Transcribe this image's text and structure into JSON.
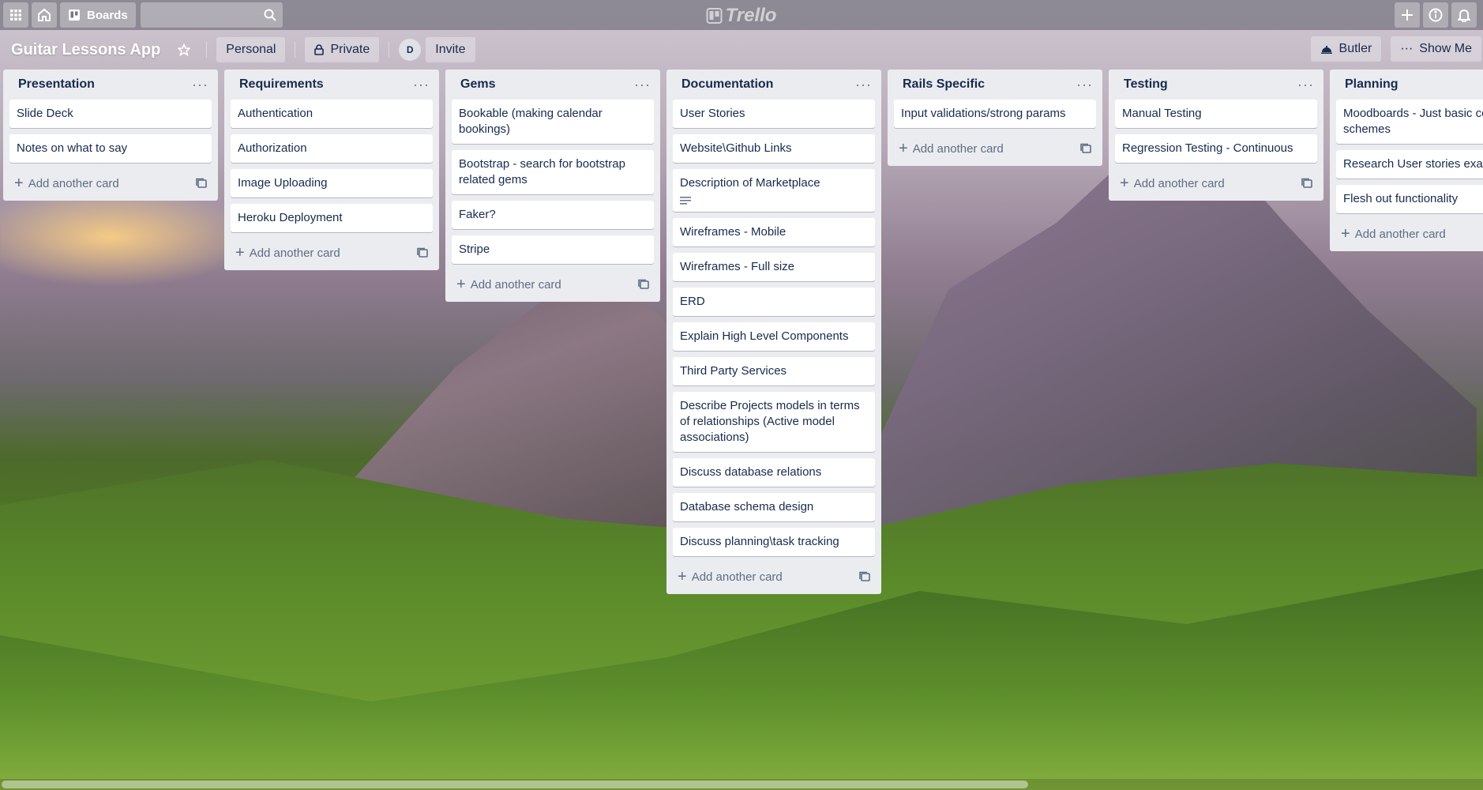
{
  "topbar": {
    "boards_label": "Boards",
    "logo_text": "Trello",
    "search_placeholder": ""
  },
  "board": {
    "title": "Guitar Lessons App",
    "visibility_team": "Personal",
    "visibility_privacy": "Private",
    "member_initial": "D",
    "invite_label": "Invite",
    "butler_label": "Butler",
    "show_menu_label": "Show Me"
  },
  "lists": [
    {
      "title": "Presentation",
      "cards": [
        "Slide Deck",
        "Notes on what to say"
      ],
      "add_label": "Add another card"
    },
    {
      "title": "Requirements",
      "cards": [
        "Authentication",
        "Authorization",
        "Image Uploading",
        "Heroku Deployment"
      ],
      "add_label": "Add another card"
    },
    {
      "title": "Gems",
      "cards": [
        "Bookable (making calendar bookings)",
        "Bootstrap - search for bootstrap related gems",
        "Faker?",
        "Stripe"
      ],
      "add_label": "Add another card"
    },
    {
      "title": "Documentation",
      "cards": [
        "User Stories",
        "Website\\Github Links",
        "Description of Marketplace",
        "Wireframes - Mobile",
        "Wireframes - Full size",
        "ERD",
        "Explain High Level Components",
        "Third Party Services",
        "Describe Projects models in terms of relationships (Active model associations)",
        "Discuss database relations",
        "Database schema design",
        "Discuss planning\\task tracking"
      ],
      "add_label": "Add another card"
    },
    {
      "title": "Rails Specific",
      "cards": [
        "Input validations/strong params"
      ],
      "add_label": "Add another card"
    },
    {
      "title": "Testing",
      "cards": [
        "Manual Testing",
        "Regression Testing - Continuous"
      ],
      "add_label": "Add another card"
    },
    {
      "title": "Planning",
      "cards": [
        "Moodboards - Just basic co schemes",
        "Research User stories exam",
        "Flesh out functionality"
      ],
      "add_label": "Add another card"
    }
  ]
}
